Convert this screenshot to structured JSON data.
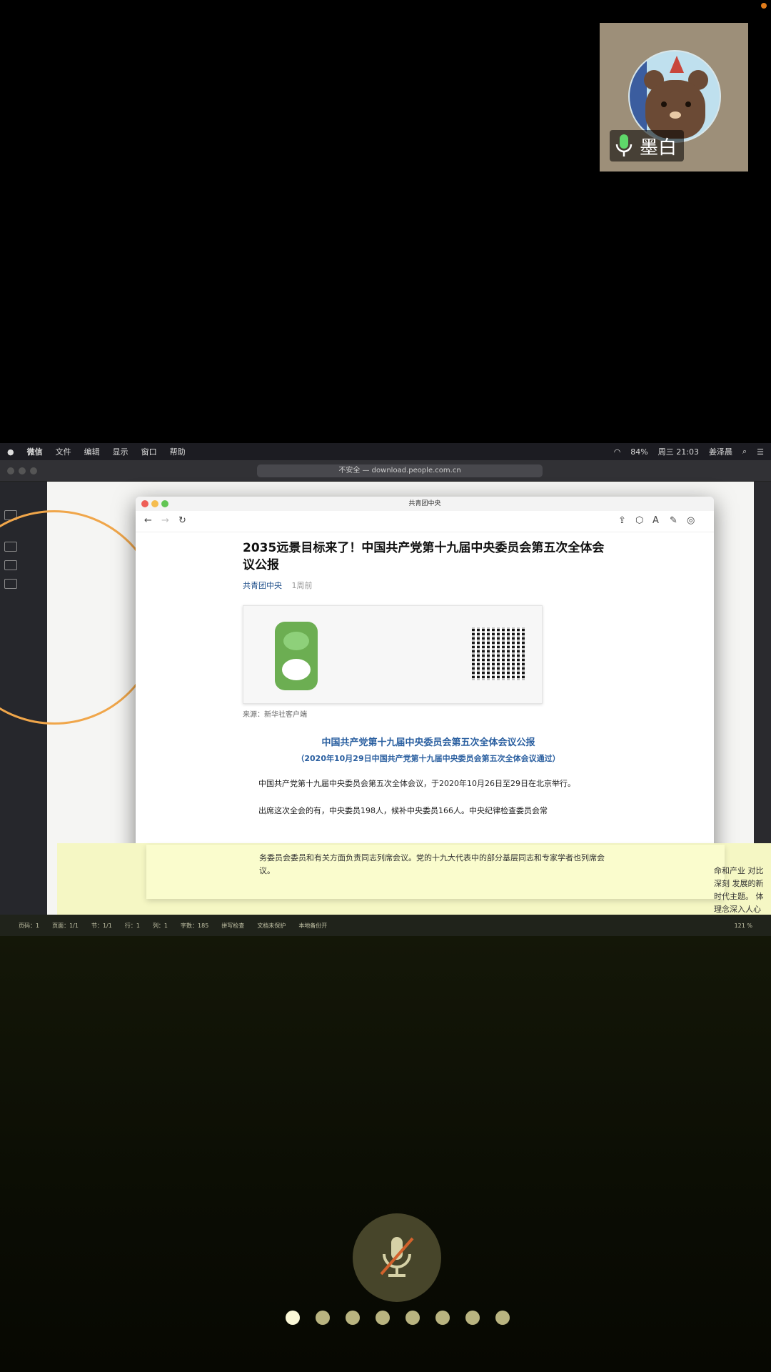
{
  "participant": {
    "name": "墨白"
  },
  "menubar": {
    "app": "微信",
    "items": [
      "文件",
      "编辑",
      "显示",
      "窗口",
      "帮助"
    ],
    "battery": "84%",
    "clock": "周三 21:03",
    "user": "姜泽晨"
  },
  "browser": {
    "url": "不安全 — download.people.com.cn"
  },
  "article": {
    "window_title": "共青团中央",
    "title": "2035远景目标来了！中国共产党第十九届中央委员会第五次全体会议公报",
    "author": "共青团中央",
    "time": "1周前",
    "source": "来源：新华社客户端",
    "headline": "中国共产党第十九届中央委员会第五次全体会议公报",
    "subheadline": "（2020年10月29日中国共产党第十九届中央委员会第五次全体会议通过）",
    "para1": "中国共产党第十九届中央委员会第五次全体会议，于2020年10月26日至29日在北京举行。",
    "para2": "出席这次全会的有，中央委员198人，候补中央委员166人。中央纪律检查委员会常",
    "para3": "务委员会委员和有关方面负责同志列席会议。党的十九大代表中的部分基层同志和专家学者也列席会议。"
  },
  "side_text": "命和产业 对比深刻 发展的新时代主题。 体理念深入人心",
  "word_status": {
    "page": "页码：1",
    "pages": "页面：1/1",
    "section": "节：1/1",
    "row": "行：1",
    "col": "列：1",
    "words": "字数：185",
    "spell": "拼写检查",
    "protect": "文档未保护",
    "backup": "本地备份开",
    "zoom": "121 %"
  },
  "controls": {
    "mute_icon": "mic-off-icon",
    "page_count": 8,
    "active_page": 0
  },
  "colors": {
    "accent_blue": "#2a5fa0",
    "dot_active": "#fbf8d7",
    "dot_inactive": "#b9b480",
    "mute_bg": "#47452a"
  }
}
